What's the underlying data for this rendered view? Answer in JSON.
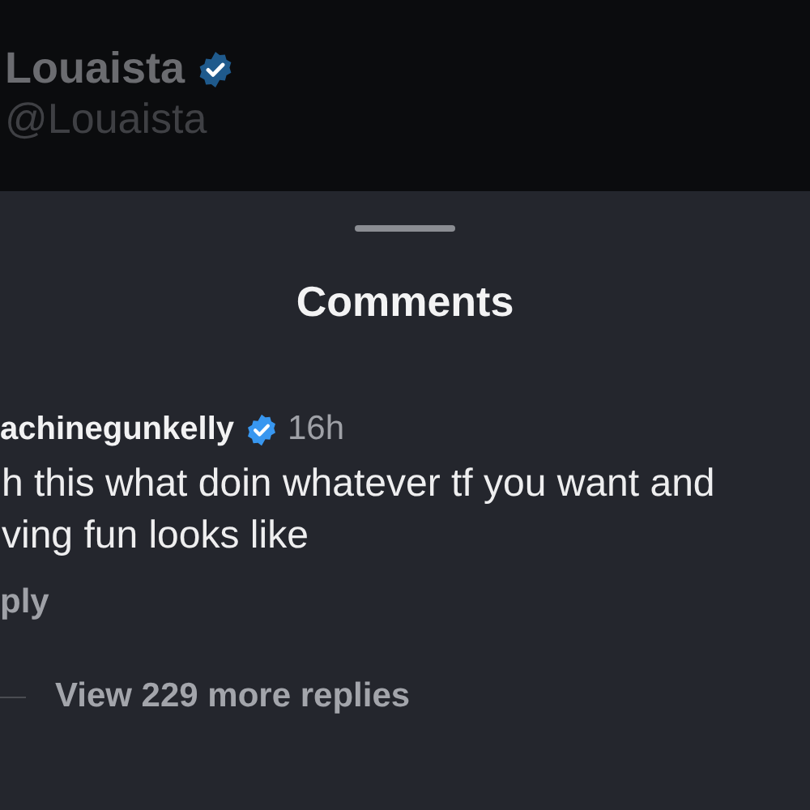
{
  "profile": {
    "name": "Louaista",
    "verified": true,
    "handle": "@Louaista"
  },
  "sheet": {
    "title": "Comments"
  },
  "comment": {
    "username": "achinegunkelly",
    "verified": true,
    "time": "16h",
    "lines": [
      "h this what doin whatever tf you want and",
      "ving fun looks like"
    ],
    "reply": "ply",
    "more_replies": "View 229 more replies"
  }
}
